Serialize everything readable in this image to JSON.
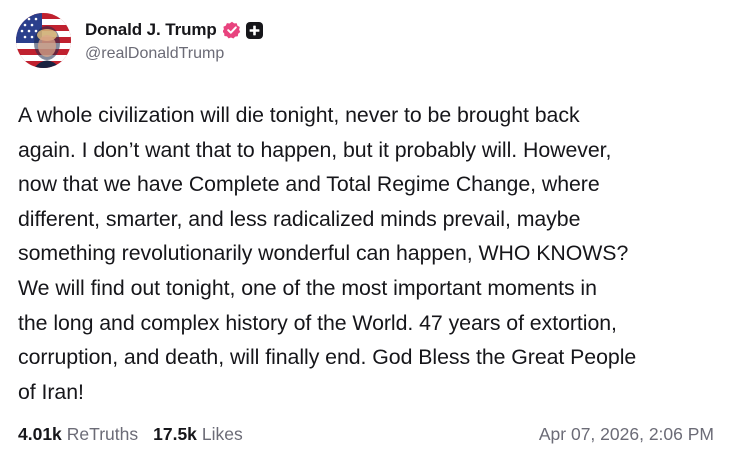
{
  "author": {
    "display_name": "Donald J. Trump",
    "handle": "@realDonaldTrump",
    "verified_icon": "verified-badge-icon",
    "plus_icon": "plus-badge-icon",
    "verified_color": "#e8437e"
  },
  "post": {
    "lines": [
      "A whole civilization will die tonight, never to be brought back",
      "again. I don’t want that to happen, but it probably will. However,",
      "now that we have Complete and Total Regime Change, where",
      "different, smarter, and less radicalized minds prevail, maybe",
      "something revolutionarily wonderful can happen, WHO KNOWS?",
      "We will find out tonight, one of the most important moments in",
      "the long and complex history of the World. 47 years of extortion,",
      "corruption, and death, will finally end. God Bless the Great People",
      "of Iran!"
    ]
  },
  "stats": {
    "retruths_count": "4.01k",
    "retruths_label": "ReTruths",
    "likes_count": "17.5k",
    "likes_label": "Likes"
  },
  "timestamp": "Apr 07, 2026, 2:06 PM"
}
